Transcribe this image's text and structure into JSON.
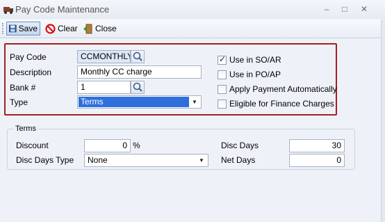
{
  "window": {
    "title": "Pay Code Maintenance"
  },
  "toolbar": {
    "save": "Save",
    "clear": "Clear",
    "close": "Close"
  },
  "form": {
    "pay_code_label": "Pay Code",
    "pay_code_value": "CCMONTHLY",
    "description_label": "Description",
    "description_value": "Monthly CC charge",
    "bank_label": "Bank #",
    "bank_value": "1",
    "type_label": "Type",
    "type_value": "Terms",
    "checkboxes": [
      {
        "label": "Use in SO/AR",
        "checked": true
      },
      {
        "label": "Use in PO/AP",
        "checked": false
      },
      {
        "label": "Apply Payment Automatically",
        "checked": false
      },
      {
        "label": "Eligible for Finance Charges",
        "checked": false
      }
    ]
  },
  "terms": {
    "group_label": "Terms",
    "discount_label": "Discount",
    "discount_value": "0",
    "discount_unit": "%",
    "disc_days_type_label": "Disc Days Type",
    "disc_days_type_value": "None",
    "disc_days_label": "Disc Days",
    "disc_days_value": "30",
    "net_days_label": "Net Days",
    "net_days_value": "0"
  },
  "icons": {
    "app": "truck-icon",
    "save": "floppy-disk-icon",
    "clear": "no-entry-icon",
    "close": "exit-door-icon",
    "lookup": "magnifier-icon"
  },
  "colors": {
    "highlight_border": "#a81e1e",
    "selection": "#2f6fdc"
  }
}
